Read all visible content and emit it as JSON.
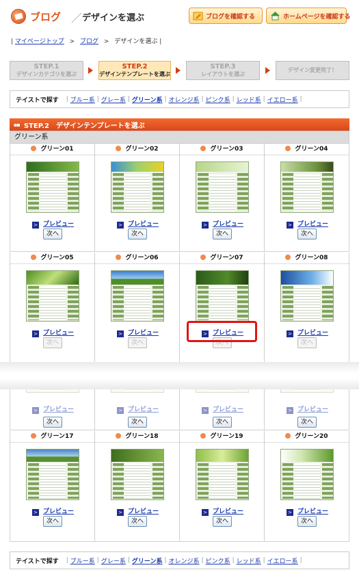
{
  "header": {
    "brand": "ブログ",
    "page_title": "デザインを選ぶ",
    "confirm_blog": "ブログを確認する",
    "confirm_home": "ホームページを確認する"
  },
  "breadcrumb": {
    "items": [
      "マイページトップ",
      "ブログ",
      "デザインを選ぶ"
    ],
    "separator": ">"
  },
  "steps": [
    {
      "num": "STEP.1",
      "label": "デザインカテゴリを選ぶ",
      "active": false
    },
    {
      "num": "STEP.2",
      "label": "デザインテンプレートを選ぶ",
      "active": true
    },
    {
      "num": "STEP.3",
      "label": "レイアウトを選ぶ",
      "active": false
    },
    {
      "num": "",
      "label": "デザイン変更完了！",
      "active": false
    }
  ],
  "taste": {
    "label": "テイストで探す",
    "options": [
      "ブルー系",
      "グレー系",
      "グリーン系",
      "オレンジ系",
      "ピンク系",
      "レッド系",
      "イエロー系"
    ],
    "current": "グリーン系"
  },
  "panel": {
    "title": "STEP.2　デザインテンプレートを選ぶ",
    "category": "グリーン系"
  },
  "actions": {
    "preview_label": "プレビュー",
    "next_label": "次へ"
  },
  "templates_row1": [
    "グリーン01",
    "グリーン02",
    "グリーン03",
    "グリーン04"
  ],
  "templates_row2": [
    "グリーン05",
    "グリーン06",
    "グリーン07",
    "グリーン08"
  ],
  "templates_row3": [
    "グリーン17",
    "グリーン18",
    "グリーン19",
    "グリーン20"
  ],
  "colors": {
    "accent": "#e05a1e",
    "link": "#1a3bb0",
    "highlight": "#e01414"
  }
}
